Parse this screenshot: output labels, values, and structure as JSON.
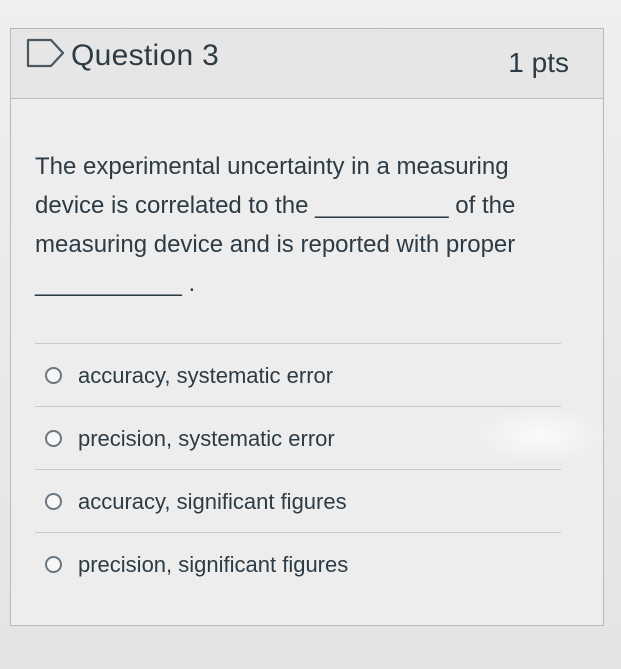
{
  "question": {
    "title": "Question 3",
    "points": "1 pts",
    "text_line1": "The experimental uncertainty in a measuring",
    "text_line2": "device is correlated to the __________ of the",
    "text_line3": "measuring device and is reported with proper",
    "text_line4": "___________ ."
  },
  "answers": [
    {
      "label": "accuracy, systematic error"
    },
    {
      "label": "precision, systematic error"
    },
    {
      "label": "accuracy, significant figures"
    },
    {
      "label": "precision, significant figures"
    }
  ],
  "icons": {
    "flag": "flag-icon",
    "radio": "radio-button"
  },
  "colors": {
    "text": "#2d3b45",
    "border": "#bcbcbc"
  }
}
